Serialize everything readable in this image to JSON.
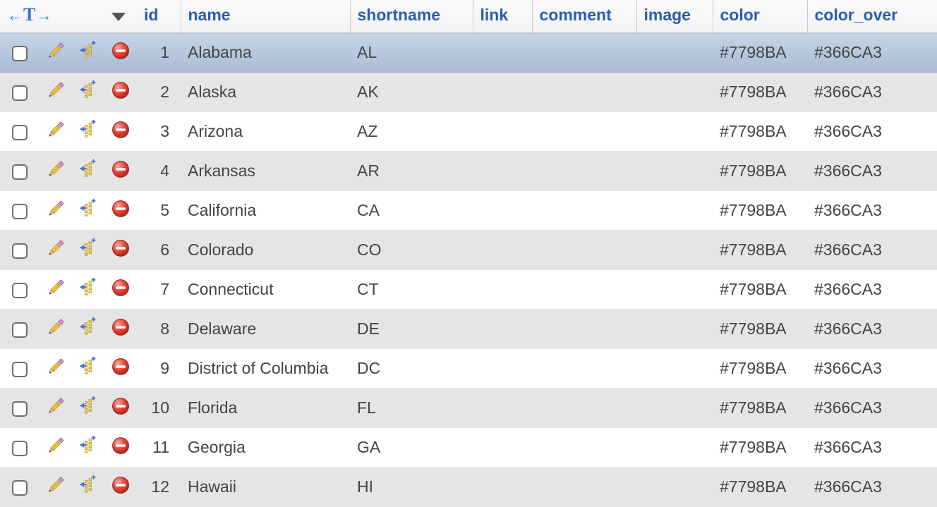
{
  "columns": {
    "id": "id",
    "name": "name",
    "shortname": "shortname",
    "link": "link",
    "comment": "comment",
    "image": "image",
    "color": "color",
    "color_over": "color_over"
  },
  "rows": [
    {
      "id": "1",
      "name": "Alabama",
      "shortname": "AL",
      "link": "",
      "comment": "",
      "image": "",
      "color": "#7798BA",
      "color_over": "#366CA3",
      "selected": true
    },
    {
      "id": "2",
      "name": "Alaska",
      "shortname": "AK",
      "link": "",
      "comment": "",
      "image": "",
      "color": "#7798BA",
      "color_over": "#366CA3",
      "selected": false
    },
    {
      "id": "3",
      "name": "Arizona",
      "shortname": "AZ",
      "link": "",
      "comment": "",
      "image": "",
      "color": "#7798BA",
      "color_over": "#366CA3",
      "selected": false
    },
    {
      "id": "4",
      "name": "Arkansas",
      "shortname": "AR",
      "link": "",
      "comment": "",
      "image": "",
      "color": "#7798BA",
      "color_over": "#366CA3",
      "selected": false
    },
    {
      "id": "5",
      "name": "California",
      "shortname": "CA",
      "link": "",
      "comment": "",
      "image": "",
      "color": "#7798BA",
      "color_over": "#366CA3",
      "selected": false
    },
    {
      "id": "6",
      "name": "Colorado",
      "shortname": "CO",
      "link": "",
      "comment": "",
      "image": "",
      "color": "#7798BA",
      "color_over": "#366CA3",
      "selected": false
    },
    {
      "id": "7",
      "name": "Connecticut",
      "shortname": "CT",
      "link": "",
      "comment": "",
      "image": "",
      "color": "#7798BA",
      "color_over": "#366CA3",
      "selected": false
    },
    {
      "id": "8",
      "name": "Delaware",
      "shortname": "DE",
      "link": "",
      "comment": "",
      "image": "",
      "color": "#7798BA",
      "color_over": "#366CA3",
      "selected": false
    },
    {
      "id": "9",
      "name": "District of Columbia",
      "shortname": "DC",
      "link": "",
      "comment": "",
      "image": "",
      "color": "#7798BA",
      "color_over": "#366CA3",
      "selected": false
    },
    {
      "id": "10",
      "name": "Florida",
      "shortname": "FL",
      "link": "",
      "comment": "",
      "image": "",
      "color": "#7798BA",
      "color_over": "#366CA3",
      "selected": false
    },
    {
      "id": "11",
      "name": "Georgia",
      "shortname": "GA",
      "link": "",
      "comment": "",
      "image": "",
      "color": "#7798BA",
      "color_over": "#366CA3",
      "selected": false
    },
    {
      "id": "12",
      "name": "Hawaii",
      "shortname": "HI",
      "link": "",
      "comment": "",
      "image": "",
      "color": "#7798BA",
      "color_over": "#366CA3",
      "selected": false
    }
  ]
}
